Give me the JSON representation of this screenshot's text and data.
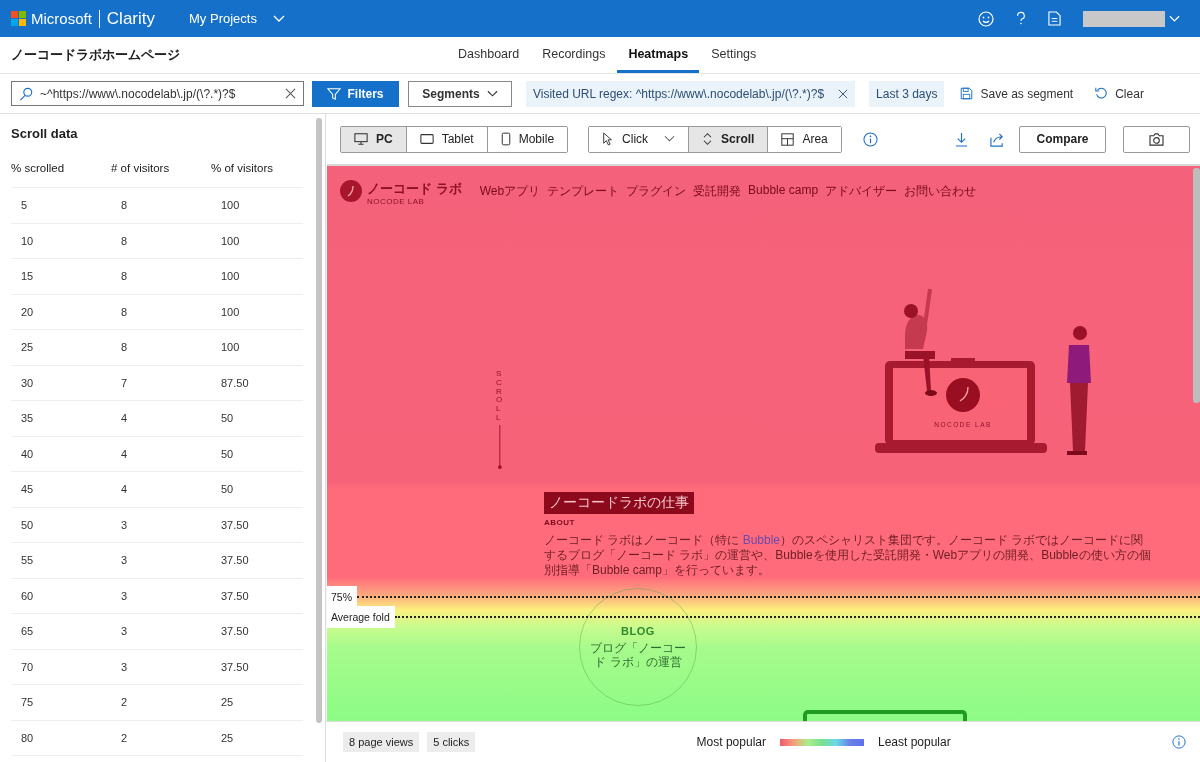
{
  "topbar": {
    "brand": "Microsoft",
    "product": "Clarity",
    "projects": "My Projects"
  },
  "project": {
    "title": "ノーコードラボホームページ",
    "tabs": [
      {
        "label": "Dashboard",
        "selected": false
      },
      {
        "label": "Recordings",
        "selected": false
      },
      {
        "label": "Heatmaps",
        "selected": true
      },
      {
        "label": "Settings",
        "selected": false
      }
    ]
  },
  "filter_bar": {
    "search": {
      "value": "~^https://www\\.nocodelab\\.jp/(\\?.*)?$"
    },
    "filters": "Filters",
    "segments": "Segments",
    "chip": "Visited URL regex: ^https://www\\.nocodelab\\.jp/(\\?.*)?$",
    "date": "Last 3 days",
    "save": "Save as segment",
    "clear": "Clear"
  },
  "scroll_data": {
    "title": "Scroll data",
    "columns": [
      "% scrolled",
      "# of visitors",
      "% of visitors"
    ],
    "rows": [
      [
        "5",
        "8",
        "100"
      ],
      [
        "10",
        "8",
        "100"
      ],
      [
        "15",
        "8",
        "100"
      ],
      [
        "20",
        "8",
        "100"
      ],
      [
        "25",
        "8",
        "100"
      ],
      [
        "30",
        "7",
        "87.50"
      ],
      [
        "35",
        "4",
        "50"
      ],
      [
        "40",
        "4",
        "50"
      ],
      [
        "45",
        "4",
        "50"
      ],
      [
        "50",
        "3",
        "37.50"
      ],
      [
        "55",
        "3",
        "37.50"
      ],
      [
        "60",
        "3",
        "37.50"
      ],
      [
        "65",
        "3",
        "37.50"
      ],
      [
        "70",
        "3",
        "37.50"
      ],
      [
        "75",
        "2",
        "25"
      ],
      [
        "80",
        "2",
        "25"
      ]
    ]
  },
  "toolbar": {
    "devices": [
      {
        "kind": "pc",
        "label": "PC",
        "selected": true
      },
      {
        "kind": "tablet",
        "label": "Tablet",
        "selected": false
      },
      {
        "kind": "mobile",
        "label": "Mobile",
        "selected": false
      }
    ],
    "modes": [
      {
        "kind": "click",
        "label": "Click",
        "selected": false
      },
      {
        "kind": "scroll",
        "label": "Scroll",
        "selected": true
      },
      {
        "kind": "area",
        "label": "Area",
        "selected": false
      }
    ],
    "compare": "Compare"
  },
  "site": {
    "logo_title": "ノーコード ラボ",
    "logo_sub": "NOCODE LAB",
    "nav": [
      "Webアプリ",
      "テンプレート",
      "プラグイン",
      "受託開発",
      "Bubble camp",
      "アドバイザー",
      "お問い合わせ"
    ],
    "scroll_label": "SCROLL",
    "laptop_label": "NOCODE LAB",
    "heading": "ノーコードラボの仕事",
    "about": "ABOUT",
    "paragraph": "ノーコード ラボはノーコード（特に **Bubble**）のスペシャリスト集団です。ノーコード ラボではノーコードに関するブログ「ノーコード ラボ」の運営や、Bubbleを使用した受託開発・Webアプリの開発、Bubbleの使い方の個別指導「Bubble camp」を行っています。",
    "blog_title": "BLOG",
    "blog_text": "ブログ「ノーコード ラボ」の運営"
  },
  "folds": [
    {
      "label": "75%"
    },
    {
      "label": "Average fold"
    }
  ],
  "footer": {
    "stats": [
      "8 page views",
      "5 clicks"
    ],
    "most": "Most popular",
    "least": "Least popular"
  }
}
